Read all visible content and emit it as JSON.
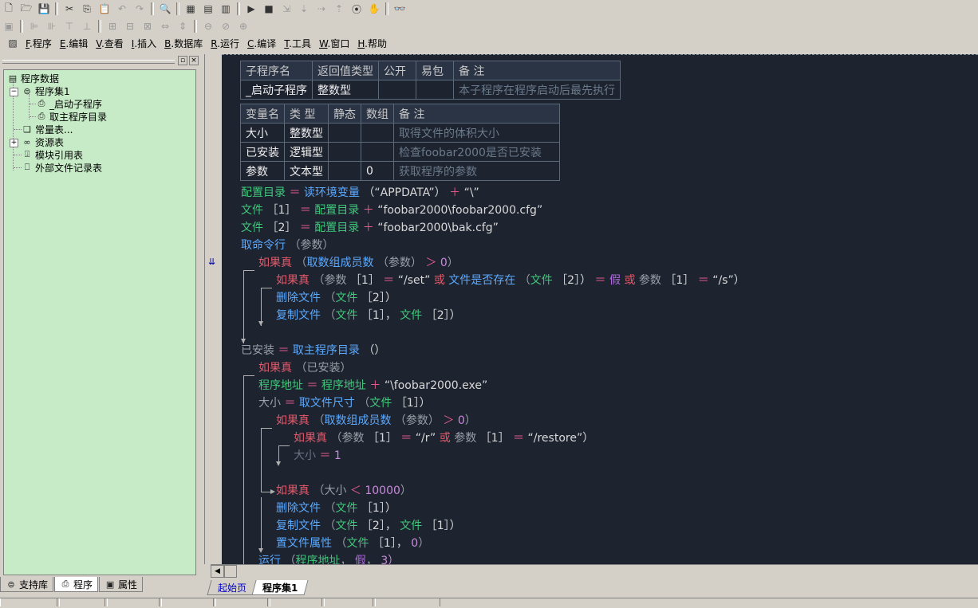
{
  "menu": [
    {
      "key": "F",
      "label": "程序"
    },
    {
      "key": "E",
      "label": "编辑"
    },
    {
      "key": "V",
      "label": "查看"
    },
    {
      "key": "I",
      "label": "插入"
    },
    {
      "key": "B",
      "label": "数据库"
    },
    {
      "key": "R",
      "label": "运行"
    },
    {
      "key": "C",
      "label": "编译"
    },
    {
      "key": "T",
      "label": "工具"
    },
    {
      "key": "W",
      "label": "窗口"
    },
    {
      "key": "H",
      "label": "帮助"
    }
  ],
  "tree": {
    "root": "程序数据",
    "set": "程序集1",
    "sub1": "_启动子程序",
    "sub2": "取主程序目录",
    "consts": "常量表...",
    "res": "资源表",
    "modref": "模块引用表",
    "extfile": "外部文件记录表"
  },
  "left_tabs": [
    "支持库",
    "程序",
    "属性"
  ],
  "doc_tabs": [
    "起始页",
    "程序集1"
  ],
  "sub_table": {
    "headers": [
      "子程序名",
      "返回值类型",
      "公开",
      "易包",
      "备 注"
    ],
    "row": [
      "_启动子程序",
      "整数型",
      "",
      "",
      "本子程序在程序启动后最先执行"
    ]
  },
  "var_table": {
    "headers": [
      "变量名",
      "类 型",
      "静态",
      "数组",
      "备 注"
    ],
    "rows": [
      [
        "大小",
        "整数型",
        "",
        "",
        "取得文件的体积大小"
      ],
      [
        "已安装",
        "逻辑型",
        "",
        "",
        "检查foobar2000是否已安装"
      ],
      [
        "参数",
        "文本型",
        "",
        "0",
        "获取程序的参数"
      ]
    ]
  },
  "code": {
    "l1": {
      "a": "配置目录",
      "b": "＝",
      "c": "读环境变量",
      "d": "（“APPDATA”）",
      "e": "＋",
      "f": "“\\”"
    },
    "l2": {
      "a": "文件",
      "b": "［1］",
      "c": "＝",
      "d": "配置目录",
      "e": "＋",
      "f": "“foobar2000\\foobar2000.cfg”"
    },
    "l3": {
      "a": "文件",
      "b": "［2］",
      "c": "＝",
      "d": "配置目录",
      "e": "＋",
      "f": "“foobar2000\\bak.cfg”"
    },
    "l4": {
      "a": "取命令行",
      "b": "（参数）"
    },
    "l5": {
      "a": "如果真",
      "b": "（",
      "c": "取数组成员数",
      "d": "（参数）",
      "e": "＞",
      "f": "0",
      "g": "）"
    },
    "l6": {
      "a": "如果真",
      "b": "（参数",
      "c": "［1］",
      "d": "＝",
      "e": "“/set”",
      "f": "或",
      "g": "文件是否存在",
      "h": "（",
      "i": "文件",
      "j": "［2］）",
      "k": "＝",
      "l": "假",
      "m": "或",
      "n": "参数",
      "o": "［1］",
      "p": "＝",
      "q": "“/s”）"
    },
    "l7": {
      "a": "删除文件",
      "b": "（",
      "c": "文件",
      "d": "［2］）"
    },
    "l8": {
      "a": "复制文件",
      "b": "（",
      "c": "文件",
      "d": "［1］，",
      "e": "文件",
      "f": "［2］）"
    },
    "l9": {
      "a": "已安装",
      "b": "＝",
      "c": "取主程序目录",
      "d": "（）"
    },
    "l10": {
      "a": "如果真",
      "b": "（已安装）"
    },
    "l11": {
      "a": "程序地址",
      "b": "＝",
      "c": "程序地址",
      "d": "＋",
      "e": "“\\foobar2000.exe”"
    },
    "l12": {
      "a": "大小",
      "b": "＝",
      "c": "取文件尺寸",
      "d": "（",
      "e": "文件",
      "f": "［1］）"
    },
    "l13": {
      "a": "如果真",
      "b": "（",
      "c": "取数组成员数",
      "d": "（参数）",
      "e": "＞",
      "f": "0",
      "g": "）"
    },
    "l14": {
      "a": "如果真",
      "b": "（参数",
      "c": "［1］",
      "d": "＝",
      "e": "“/r”",
      "f": "或",
      "g": "参数",
      "h": "［1］",
      "i": "＝",
      "j": "“/restore”）"
    },
    "l15": {
      "a": "大小",
      "b": "＝",
      "c": "1"
    },
    "l16": {
      "a": "如果真",
      "b": "（大小",
      "c": "＜",
      "d": "10000",
      "e": "）"
    },
    "l17": {
      "a": "删除文件",
      "b": "（",
      "c": "文件",
      "d": "［1］）"
    },
    "l18": {
      "a": "复制文件",
      "b": "（",
      "c": "文件",
      "d": "［2］，",
      "e": "文件",
      "f": "［1］）"
    },
    "l19": {
      "a": "置文件属性",
      "b": "（",
      "c": "文件",
      "d": "［1］，",
      "e": "0",
      "f": "）"
    },
    "l20": {
      "a": "运行",
      "b": "（",
      "c": "程序地址",
      "d": "，",
      "e": "假",
      "f": "，",
      "g": "3）"
    }
  }
}
